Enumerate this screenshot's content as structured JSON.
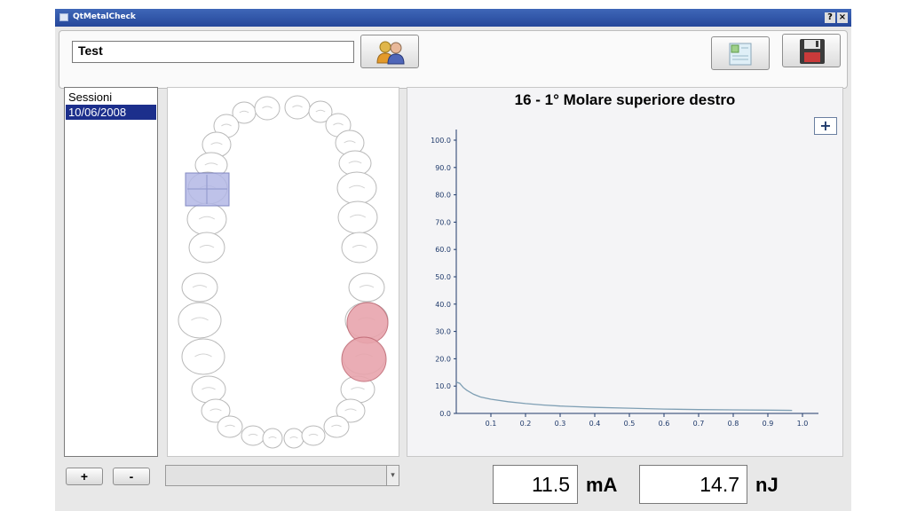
{
  "window": {
    "title": "QtMetalCheck",
    "help_label": "?",
    "close_label": "×"
  },
  "toolbar": {
    "name_value": "Test",
    "patients_icon": "patients-icon",
    "report_icon": "report-icon",
    "save_icon": "floppy-disk-icon"
  },
  "sessions": {
    "header": "Sessioni",
    "items": [
      "10/06/2008"
    ],
    "add_label": "+",
    "remove_label": "-"
  },
  "dental_chart": {
    "selected_tooth_color": "#b3b8e6",
    "measured_tooth_color": "#e8a5ad"
  },
  "graph": {
    "title": "16 - 1° Molare superiore destro",
    "zoom_label": "+"
  },
  "chart_data": {
    "type": "line",
    "title": "16 - 1° Molare superiore destro",
    "xlabel": "",
    "ylabel": "",
    "xlim": [
      0,
      1.0
    ],
    "ylim": [
      0,
      100
    ],
    "x_ticks": [
      "0.1",
      "0.2",
      "0.3",
      "0.4",
      "0.5",
      "0.6",
      "0.7",
      "0.8",
      "0.9",
      "1.0"
    ],
    "y_ticks": [
      "0.0",
      "10.0",
      "20.0",
      "30.0",
      "40.0",
      "50.0",
      "60.0",
      "70.0",
      "80.0",
      "90.0",
      "100.0"
    ],
    "grid": false,
    "line_color": "#7f9fb4",
    "series": [
      {
        "x": [
          0.0,
          0.01,
          0.02,
          0.03,
          0.05,
          0.07,
          0.1,
          0.15,
          0.2,
          0.25,
          0.3,
          0.4,
          0.5,
          0.6,
          0.7,
          0.8,
          0.9,
          0.97
        ],
        "y": [
          11.5,
          11,
          9.5,
          8.5,
          7,
          6,
          5.2,
          4.3,
          3.6,
          3.1,
          2.7,
          2.2,
          1.9,
          1.6,
          1.4,
          1.3,
          1.2,
          1.1
        ]
      }
    ]
  },
  "readout": {
    "current_value": "11.5",
    "current_unit": "mA",
    "energy_value": "14.7",
    "energy_unit": "nJ"
  }
}
